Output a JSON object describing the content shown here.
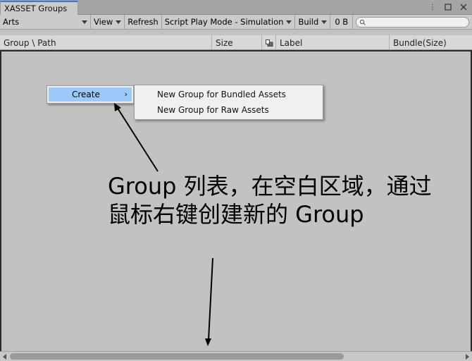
{
  "window": {
    "tab_title": "XASSET Groups"
  },
  "toolbar": {
    "group_selector": "Arts",
    "view_label": "View",
    "refresh_label": "Refresh",
    "play_mode_label": "Script Play Mode - Simulation",
    "build_label": "Build",
    "size_total": "0 B",
    "search_placeholder": ""
  },
  "columns": {
    "group_path": "Group \\ Path",
    "size": "Size",
    "label": "Label",
    "bundle_size": "Bundle(Size)"
  },
  "context_menu": {
    "create_label": "Create",
    "submenu_items": [
      "New Group for Bundled Assets",
      "New Group for Raw Assets"
    ]
  },
  "annotation": {
    "line1": "Group 列表，在空白区域，通过",
    "line2": "鼠标右键创建新的 Group"
  },
  "icons": [
    "kebab-icon",
    "maximize-icon",
    "close-icon",
    "search-icon",
    "dropdown-caret-icon",
    "asset-type-icon",
    "submenu-arrow-icon",
    "scroll-left-icon",
    "scroll-right-icon"
  ]
}
